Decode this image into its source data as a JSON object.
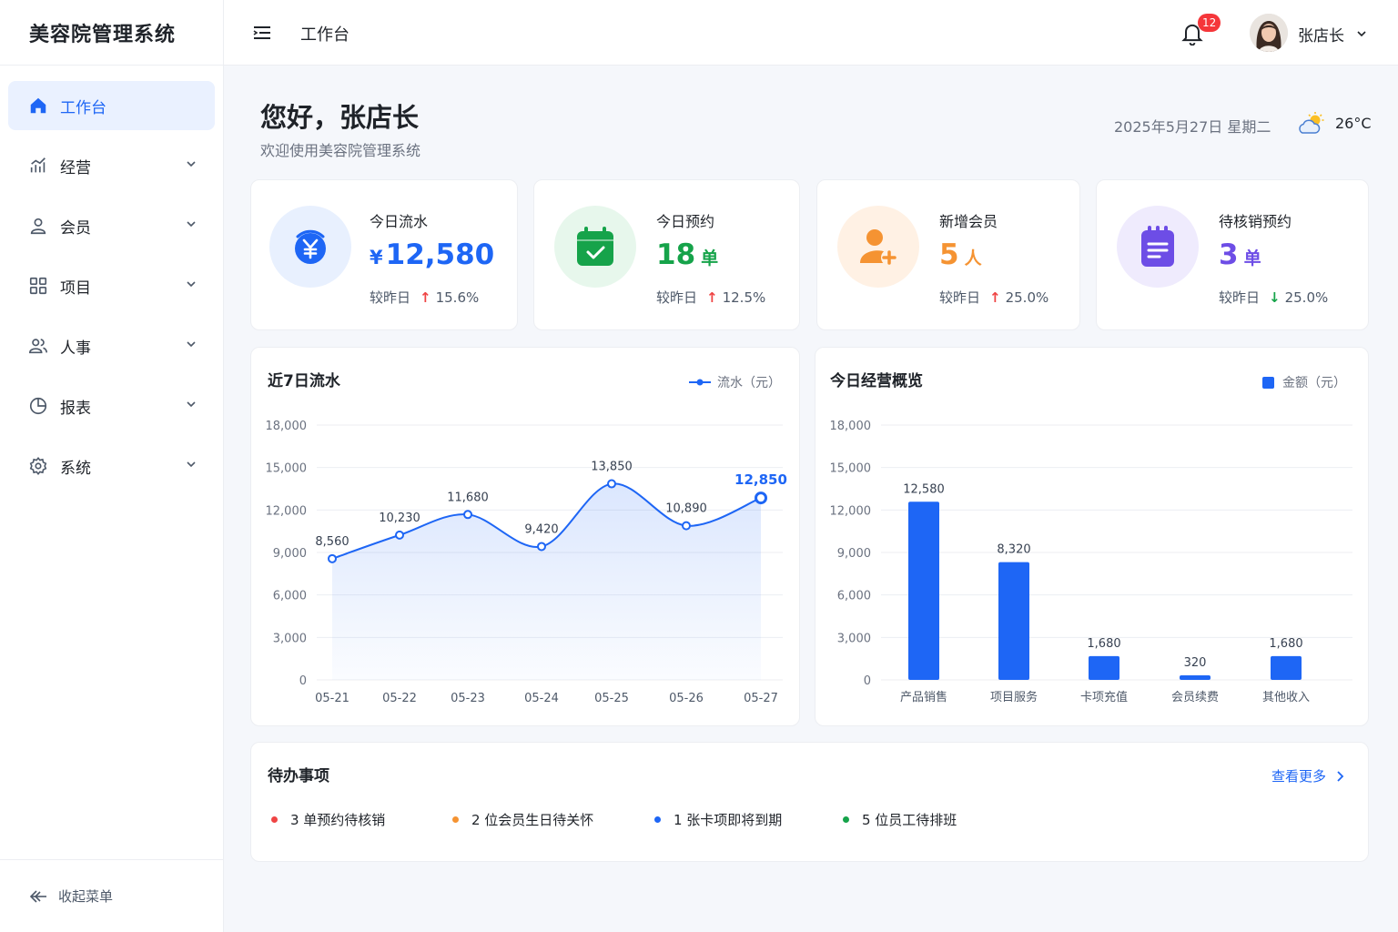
{
  "app": {
    "title": "美容院管理系统"
  },
  "sidebar": {
    "items": [
      {
        "label": "工作台",
        "icon": "home-icon",
        "active": true
      },
      {
        "label": "经营",
        "icon": "chart-icon"
      },
      {
        "label": "会员",
        "icon": "user-icon"
      },
      {
        "label": "项目",
        "icon": "grid-icon"
      },
      {
        "label": "人事",
        "icon": "users-icon"
      },
      {
        "label": "报表",
        "icon": "pie-icon"
      },
      {
        "label": "系统",
        "icon": "gear-icon"
      }
    ],
    "collapse_label": "收起菜单"
  },
  "header": {
    "title": "工作台",
    "notification_count": "12",
    "user_name": "张店长"
  },
  "welcome": {
    "greeting": "您好，张店长",
    "subtitle": "欢迎使用美容院管理系统",
    "date": "2025年5月27日 星期二",
    "temperature": "26°C"
  },
  "stats": [
    {
      "label": "今日流水",
      "prefix": "¥",
      "value": "12,580",
      "unit": "",
      "compare_label": "较昨日",
      "direction": "up",
      "change": "15.6%",
      "color": "#1e66f5"
    },
    {
      "label": "今日预约",
      "prefix": "",
      "value": "18",
      "unit": "单",
      "compare_label": "较昨日",
      "direction": "up",
      "change": "12.5%",
      "color": "#16a34a"
    },
    {
      "label": "新增会员",
      "prefix": "",
      "value": "5",
      "unit": "人",
      "compare_label": "较昨日",
      "direction": "up",
      "change": "25.0%",
      "color": "#f59332"
    },
    {
      "label": "待核销预约",
      "prefix": "",
      "value": "3",
      "unit": "单",
      "compare_label": "较昨日",
      "direction": "down",
      "change": "25.0%",
      "color": "#6d4de6"
    }
  ],
  "chart_data": [
    {
      "type": "area",
      "title": "近7日流水",
      "legend": "流水（元）",
      "legend_position": "top-right",
      "categories": [
        "05-21",
        "05-22",
        "05-23",
        "05-24",
        "05-25",
        "05-26",
        "05-27"
      ],
      "values": [
        8560,
        10230,
        11680,
        9420,
        13850,
        10890,
        12850
      ],
      "value_labels": [
        "8,560",
        "10,230",
        "11,680",
        "9,420",
        "13,850",
        "10,890",
        "12,850"
      ],
      "ylim": [
        0,
        18000
      ],
      "yticks": [
        "0",
        "3,000",
        "6,000",
        "9,000",
        "12,000",
        "15,000",
        "18,000"
      ],
      "grid": true,
      "color": "#1e66f5"
    },
    {
      "type": "bar",
      "title": "今日经营概览",
      "legend": "金额（元）",
      "legend_position": "top-right",
      "categories": [
        "产品销售",
        "项目服务",
        "卡项充值",
        "会员续费",
        "其他收入"
      ],
      "values": [
        12580,
        8320,
        1680,
        320,
        1680
      ],
      "value_labels": [
        "12,580",
        "8,320",
        "1,680",
        "320",
        "1,680"
      ],
      "ylim": [
        0,
        18000
      ],
      "yticks": [
        "0",
        "3,000",
        "6,000",
        "9,000",
        "12,000",
        "15,000",
        "18,000"
      ],
      "grid": true,
      "color": "#1e66f5"
    }
  ],
  "todos": {
    "title": "待办事项",
    "more_label": "查看更多",
    "items": [
      {
        "text": "3 单预约待核销",
        "color": "#ef4444"
      },
      {
        "text": "2 位会员生日待关怀",
        "color": "#f59332"
      },
      {
        "text": "1 张卡项即将到期",
        "color": "#1e66f5"
      },
      {
        "text": "5 位员工待排班",
        "color": "#16a34a"
      }
    ]
  }
}
